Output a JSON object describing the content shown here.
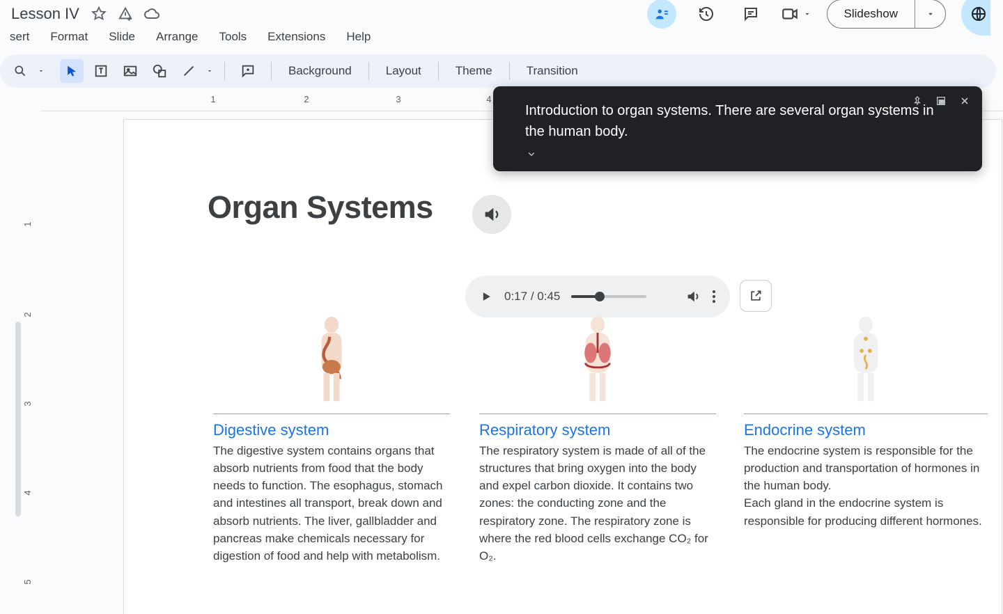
{
  "doc": {
    "title": "Lesson IV"
  },
  "menus": {
    "insert": "sert",
    "format": "Format",
    "slide": "Slide",
    "arrange": "Arrange",
    "tools": "Tools",
    "extensions": "Extensions",
    "help": "Help"
  },
  "header": {
    "slideshow": "Slideshow"
  },
  "toolbar": {
    "background": "Background",
    "layout": "Layout",
    "theme": "Theme",
    "transition": "Transition"
  },
  "ruler_h": {
    "marks": [
      1,
      2,
      3,
      4
    ]
  },
  "ruler_v": {
    "marks": [
      1,
      2,
      3,
      4,
      5
    ]
  },
  "slide": {
    "title": "Organ Systems",
    "audio": {
      "current": "0:17",
      "total": "0:45"
    },
    "columns": [
      {
        "heading": "Digestive system",
        "body": "The digestive system contains organs that absorb nutrients from food that the body needs to function. The esophagus, stomach and intestines all transport, break down and absorb nutrients. The liver, gallbladder and pancreas make chemicals necessary for digestion of food and help with metabolism."
      },
      {
        "heading": "Respiratory system",
        "body": "The respiratory system is made of all of the structures that bring oxygen into the body and expel carbon dioxide. It contains two zones: the conducting zone and the respiratory zone. The respiratory zone is where the red blood cells exchange CO₂ for O₂."
      },
      {
        "heading": "Endocrine system",
        "body": "The endocrine system is responsible for the production and transportation of hormones in the human body.\nEach gland in the endocrine system is responsible for producing different hormones."
      }
    ]
  },
  "caption": {
    "text": "Introduction to organ systems. There are several organ systems in the human body."
  }
}
